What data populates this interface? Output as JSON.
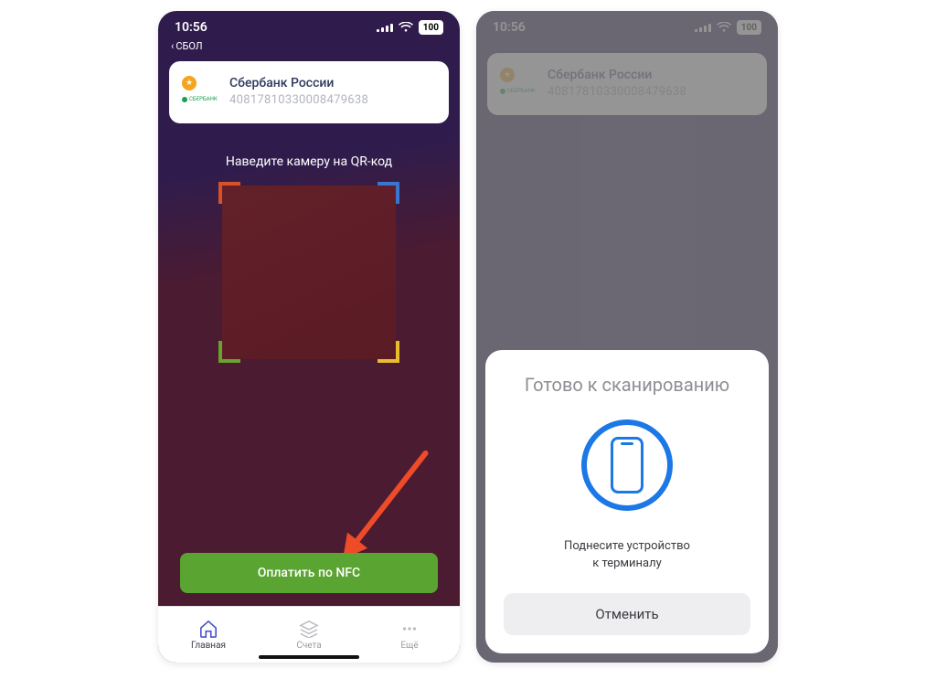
{
  "status": {
    "time": "10:56",
    "back_label": "СБОЛ",
    "battery": "100"
  },
  "bank_card": {
    "name": "Сбербанк России",
    "account": "40817810330008479638",
    "logo_text": "СБЕРБАНК"
  },
  "qr": {
    "hint": "Наведите камеру на QR-код"
  },
  "nfc_button": "Оплатить по NFC",
  "nav": {
    "items": [
      {
        "label": "Главная"
      },
      {
        "label": "Счета"
      },
      {
        "label": "Ещё"
      }
    ]
  },
  "sheet": {
    "title": "Готово к сканированию",
    "subtitle_line1": "Поднесите устройство",
    "subtitle_line2": "к терминалу",
    "cancel": "Отменить"
  }
}
